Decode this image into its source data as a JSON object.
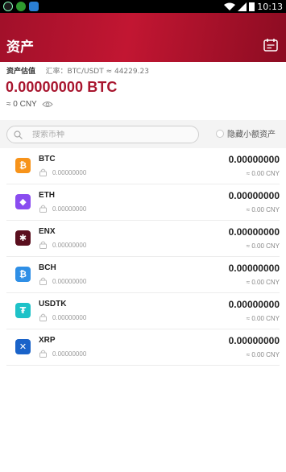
{
  "status_bar": {
    "time": "10:13"
  },
  "header": {
    "title": "资产"
  },
  "summary": {
    "estimate_label": "资产估值",
    "rate_label": "汇率：BTC/USDT ≈ 44229.23",
    "total_btc": "0.00000000 BTC",
    "total_cny": "≈ 0 CNY"
  },
  "search": {
    "placeholder": "搜索币种",
    "hide_small_label": "隐藏小额资产"
  },
  "coins": [
    {
      "name": "BTC",
      "frozen": "0.00000000",
      "amount": "0.00000000",
      "cny": "≈ 0.00 CNY",
      "color": "#f7931a",
      "glyph": "₿"
    },
    {
      "name": "ETH",
      "frozen": "0.00000000",
      "amount": "0.00000000",
      "cny": "≈ 0.00 CNY",
      "color": "#8a4cf0",
      "glyph": "◆"
    },
    {
      "name": "ENX",
      "frozen": "0.00000000",
      "amount": "0.00000000",
      "cny": "≈ 0.00 CNY",
      "color": "#5a0f1e",
      "glyph": "✱"
    },
    {
      "name": "BCH",
      "frozen": "0.00000000",
      "amount": "0.00000000",
      "cny": "≈ 0.00 CNY",
      "color": "#2f8fe6",
      "glyph": "₿"
    },
    {
      "name": "USDTK",
      "frozen": "0.00000000",
      "amount": "0.00000000",
      "cny": "≈ 0.00 CNY",
      "color": "#1ec2c8",
      "glyph": "₮"
    },
    {
      "name": "XRP",
      "frozen": "0.00000000",
      "amount": "0.00000000",
      "cny": "≈ 0.00 CNY",
      "color": "#1a63c9",
      "glyph": "✕"
    }
  ],
  "colors": {
    "brand": "#b5142e",
    "total_text": "#a8152e"
  }
}
